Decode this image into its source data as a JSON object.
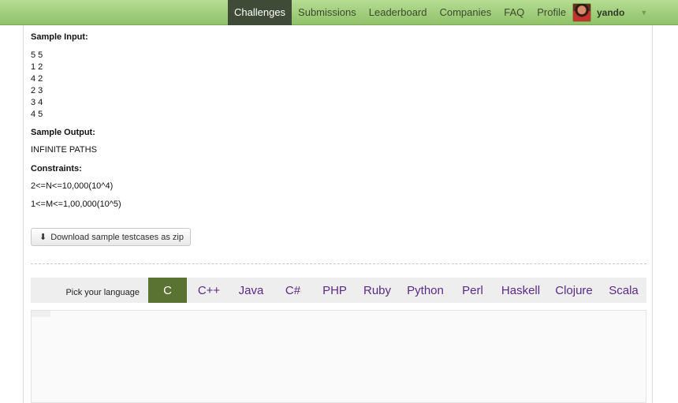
{
  "nav": {
    "items": [
      "Challenges",
      "Submissions",
      "Leaderboard",
      "Companies",
      "FAQ",
      "Profile"
    ],
    "active": "Challenges",
    "username": "yando"
  },
  "problem": {
    "sample_input_label": "Sample Input:",
    "sample_input_lines": [
      "5 5",
      "1 2",
      "4 2",
      "2 3",
      "3 4",
      "4 5"
    ],
    "sample_output_label": "Sample Output:",
    "sample_output": "INFINITE PATHS",
    "constraints_label": "Constraints:",
    "constraints": [
      "2<=N<=10,000(10^4)",
      "1<=M<=1,00,000(10^5)"
    ],
    "download_label": "Download sample testcases as zip"
  },
  "languages": {
    "label": "Pick your language",
    "items": [
      "C",
      "C++",
      "Java",
      "C#",
      "PHP",
      "Ruby",
      "Python",
      "Perl",
      "Haskell",
      "Clojure",
      "Scala"
    ],
    "active": "C"
  },
  "colors": {
    "nav_active_bg": "#3f4a37",
    "lang_active_bg": "#5a7333",
    "lang_text": "#5b2a86"
  }
}
